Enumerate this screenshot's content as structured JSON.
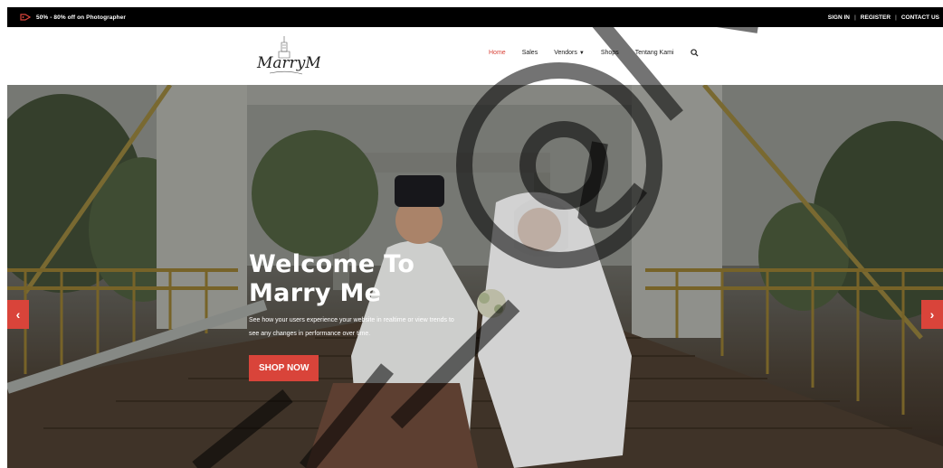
{
  "topbar": {
    "promo_text": "50% - 80% off on Photographer",
    "links": [
      "SIGN IN",
      "REGISTER",
      "CONTACT US"
    ],
    "separator": "|"
  },
  "nav": {
    "logo_text": "MarryMe",
    "items": [
      {
        "label": "Home",
        "active": true
      },
      {
        "label": "Sales",
        "active": false
      },
      {
        "label": "Vendors",
        "active": false,
        "has_dropdown": true
      },
      {
        "label": "Shops",
        "active": false
      },
      {
        "label": "Tentang Kami",
        "active": false
      }
    ],
    "search_icon": "search-icon"
  },
  "hero": {
    "title": "Welcome To\nMarry Me",
    "subtitle": "See how your users experience your website in realtime or view trends to see any changes in performance over time.",
    "cta": "SHOP NOW",
    "prev_label": "‹",
    "next_label": "›"
  },
  "colors": {
    "accent": "#d9443a",
    "topbar_bg": "#000000",
    "nav_bg": "#ffffff"
  }
}
